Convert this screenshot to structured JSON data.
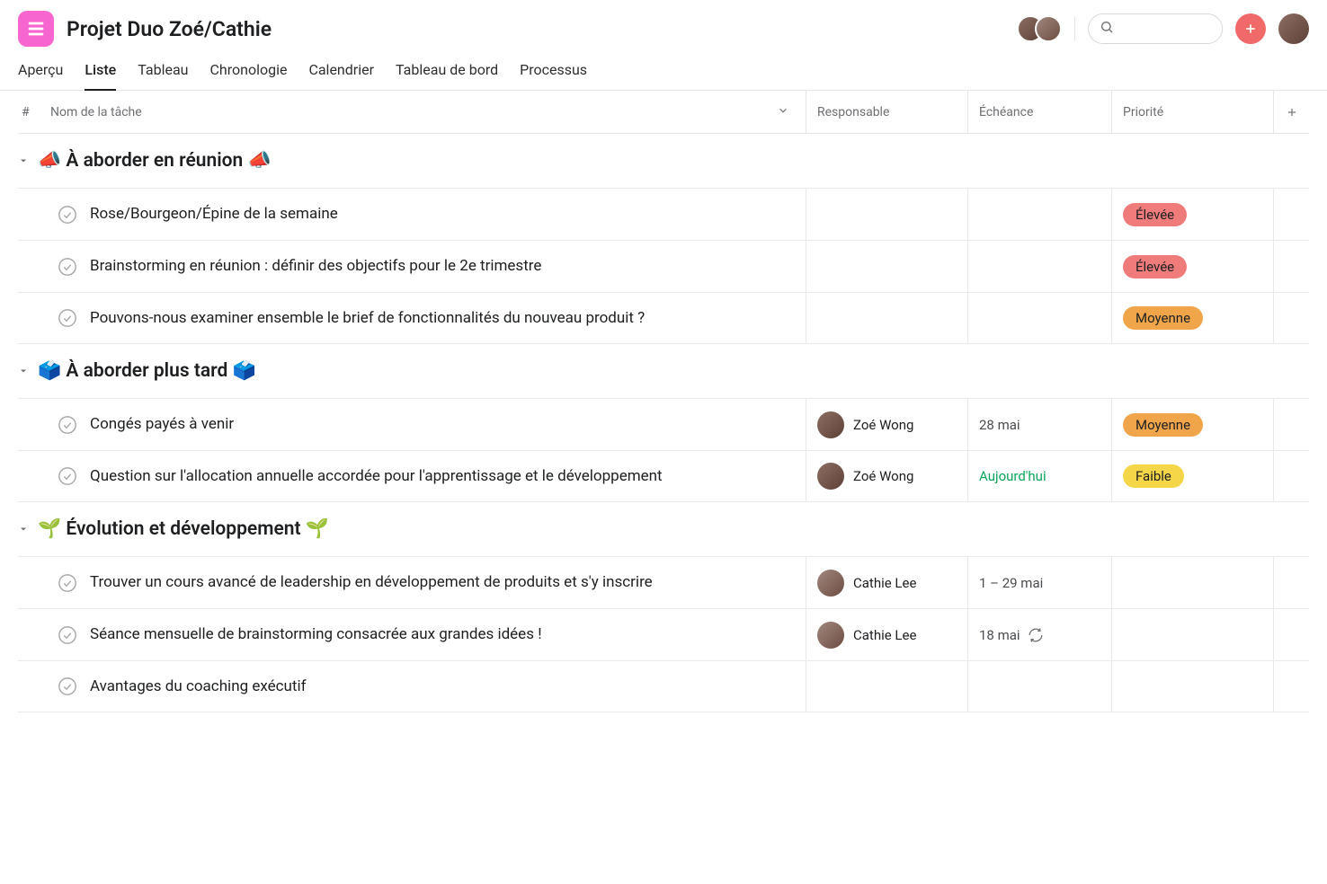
{
  "header": {
    "title": "Projet Duo Zoé/Cathie"
  },
  "tabs": [
    {
      "key": "overview",
      "label": "Aperçu",
      "active": false
    },
    {
      "key": "list",
      "label": "Liste",
      "active": true
    },
    {
      "key": "board",
      "label": "Tableau",
      "active": false
    },
    {
      "key": "timeline",
      "label": "Chronologie",
      "active": false
    },
    {
      "key": "calendar",
      "label": "Calendrier",
      "active": false
    },
    {
      "key": "dashboard",
      "label": "Tableau de bord",
      "active": false
    },
    {
      "key": "process",
      "label": "Processus",
      "active": false
    }
  ],
  "columns": {
    "hash": "#",
    "name": "Nom de la tâche",
    "assignee": "Responsable",
    "due": "Échéance",
    "priority": "Priorité"
  },
  "priority_labels": {
    "high": "Élevée",
    "medium": "Moyenne",
    "low": "Faible"
  },
  "assignees": {
    "zoe": "Zoé Wong",
    "cathie": "Cathie Lee"
  },
  "sections": [
    {
      "id": "meeting",
      "title": "📣 À aborder en réunion 📣",
      "tasks": [
        {
          "name": "Rose/Bourgeon/Épine de la semaine",
          "assignee": null,
          "due": null,
          "priority": "high"
        },
        {
          "name": "Brainstorming en réunion : définir des objectifs pour le 2e trimestre",
          "assignee": null,
          "due": null,
          "priority": "high"
        },
        {
          "name": "Pouvons-nous examiner ensemble le brief de fonctionnalités du nouveau produit ?",
          "assignee": null,
          "due": null,
          "priority": "medium"
        }
      ]
    },
    {
      "id": "later",
      "title": "🗳️ À aborder plus tard 🗳️",
      "tasks": [
        {
          "name": "Congés payés à venir",
          "assignee": "zoe",
          "due": "28 mai",
          "due_type": "normal",
          "priority": "medium"
        },
        {
          "name": "Question sur l'allocation annuelle accordée pour l'apprentissage et le développement",
          "assignee": "zoe",
          "due": "Aujourd'hui",
          "due_type": "today",
          "priority": "low"
        }
      ]
    },
    {
      "id": "growth",
      "title": "🌱 Évolution et développement 🌱",
      "tasks": [
        {
          "name": "Trouver un cours avancé de leadership en développement de produits et s'y inscrire",
          "assignee": "cathie",
          "due": "1 – 29 mai",
          "due_type": "normal",
          "priority": null
        },
        {
          "name": "Séance mensuelle de brainstorming consacrée aux grandes idées !",
          "assignee": "cathie",
          "due": "18 mai",
          "due_type": "normal",
          "recurring": true,
          "priority": null
        },
        {
          "name": "Avantages du coaching exécutif",
          "assignee": null,
          "due": null,
          "priority": null
        }
      ]
    }
  ]
}
